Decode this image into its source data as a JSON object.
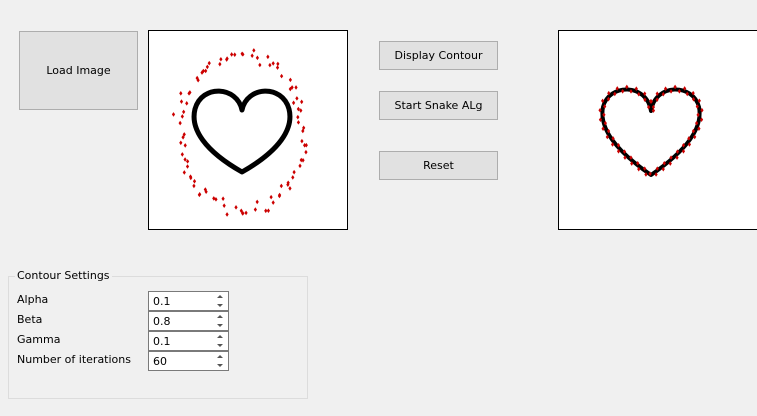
{
  "buttons": {
    "load_image": "Load Image",
    "display_contour": "Display Contour",
    "start_snake": "Start Snake ALg",
    "reset": "Reset"
  },
  "contour_settings": {
    "title": "Contour Settings",
    "fields": [
      {
        "label": "Alpha",
        "value": "0.1"
      },
      {
        "label": "Beta",
        "value": "0.8"
      },
      {
        "label": "Gamma",
        "value": "0.1"
      },
      {
        "label": "Number of iterations",
        "value": "60"
      }
    ]
  },
  "colors": {
    "shape": "#000000",
    "contour_points": "#cc0000",
    "button_bg": "#e1e1e1",
    "window_bg": "#f0f0f0"
  }
}
